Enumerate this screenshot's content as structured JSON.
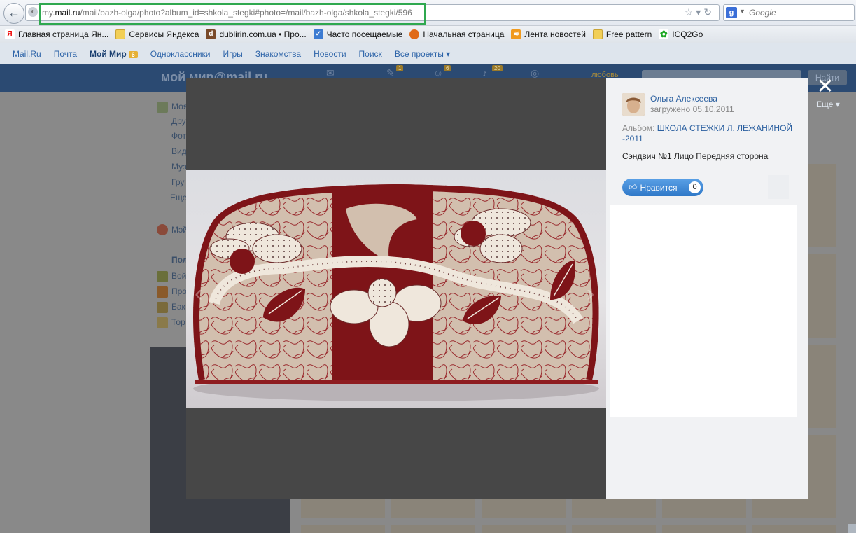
{
  "browser": {
    "url_prefix": "my.",
    "url_host": "mail.ru",
    "url_path": "/mail/bazh-olga/photo?album_id=shkola_stegki#photo=/mail/bazh-olga/shkola_stegki/596",
    "search_engine_letter": "g",
    "search_placeholder": "Google",
    "back_glyph": "←",
    "url_icons": "☆▾↻"
  },
  "bookmarks": [
    {
      "label": "Главная страница Ян...",
      "icon": "yandex-icon",
      "glyph": "Я"
    },
    {
      "label": "Сервисы Яндекса",
      "icon": "folder-icon",
      "glyph": ""
    },
    {
      "label": "dublirin.com.ua • Про...",
      "icon": "dublirin-icon",
      "glyph": "d"
    },
    {
      "label": "Часто посещаемые",
      "icon": "frequent-icon",
      "glyph": "✓"
    },
    {
      "label": "Начальная страница",
      "icon": "firefox-icon",
      "glyph": ""
    },
    {
      "label": "Лента новостей",
      "icon": "rss-icon",
      "glyph": "≋"
    },
    {
      "label": "Free pattern",
      "icon": "folder-icon",
      "glyph": ""
    },
    {
      "label": "ICQ2Go",
      "icon": "icq-icon",
      "glyph": "✿"
    }
  ],
  "portal_nav": {
    "items": [
      "Mail.Ru",
      "Почта",
      "Мой Мир",
      "Одноклассники",
      "Игры",
      "Знакомства",
      "Новости",
      "Поиск",
      "Все проекты ▾"
    ],
    "moimir_badge": "6"
  },
  "mm_header": {
    "logo": "мой мир@mail.ru",
    "find_label": "Найти",
    "badge_messages": "1",
    "badge_friends": "6",
    "badge_events": "20",
    "love_label": "любовь",
    "more_label": "Еще ▾"
  },
  "side_menu": [
    "Моя",
    "Дру",
    "Фот",
    "Вид",
    "Муз",
    "Гру",
    "Еще",
    "Мэй",
    "Пол",
    "Вой",
    "Про",
    "Бак",
    "Тор"
  ],
  "modal": {
    "author_name": "Ольга Алексеева",
    "uploaded_text": "загружено 05.10.2011",
    "album_label": "Альбом:",
    "album_name": "ШКОЛА СТЕЖКИ Л. ЛЕЖАНИНОЙ -2011",
    "caption": "Сэндвич №1 Лицо Передняя сторона",
    "like_label": "Нравится",
    "like_count": "0",
    "close_glyph": "✕",
    "prev_glyph": "‹",
    "next_glyph": "›"
  },
  "colors": {
    "quilt_red": "#7e1418",
    "quilt_beige": "#d2bfae",
    "applique_cream": "#efe7dc",
    "accent_blue": "#2f78c8",
    "highlight_green": "#2fa84f"
  }
}
